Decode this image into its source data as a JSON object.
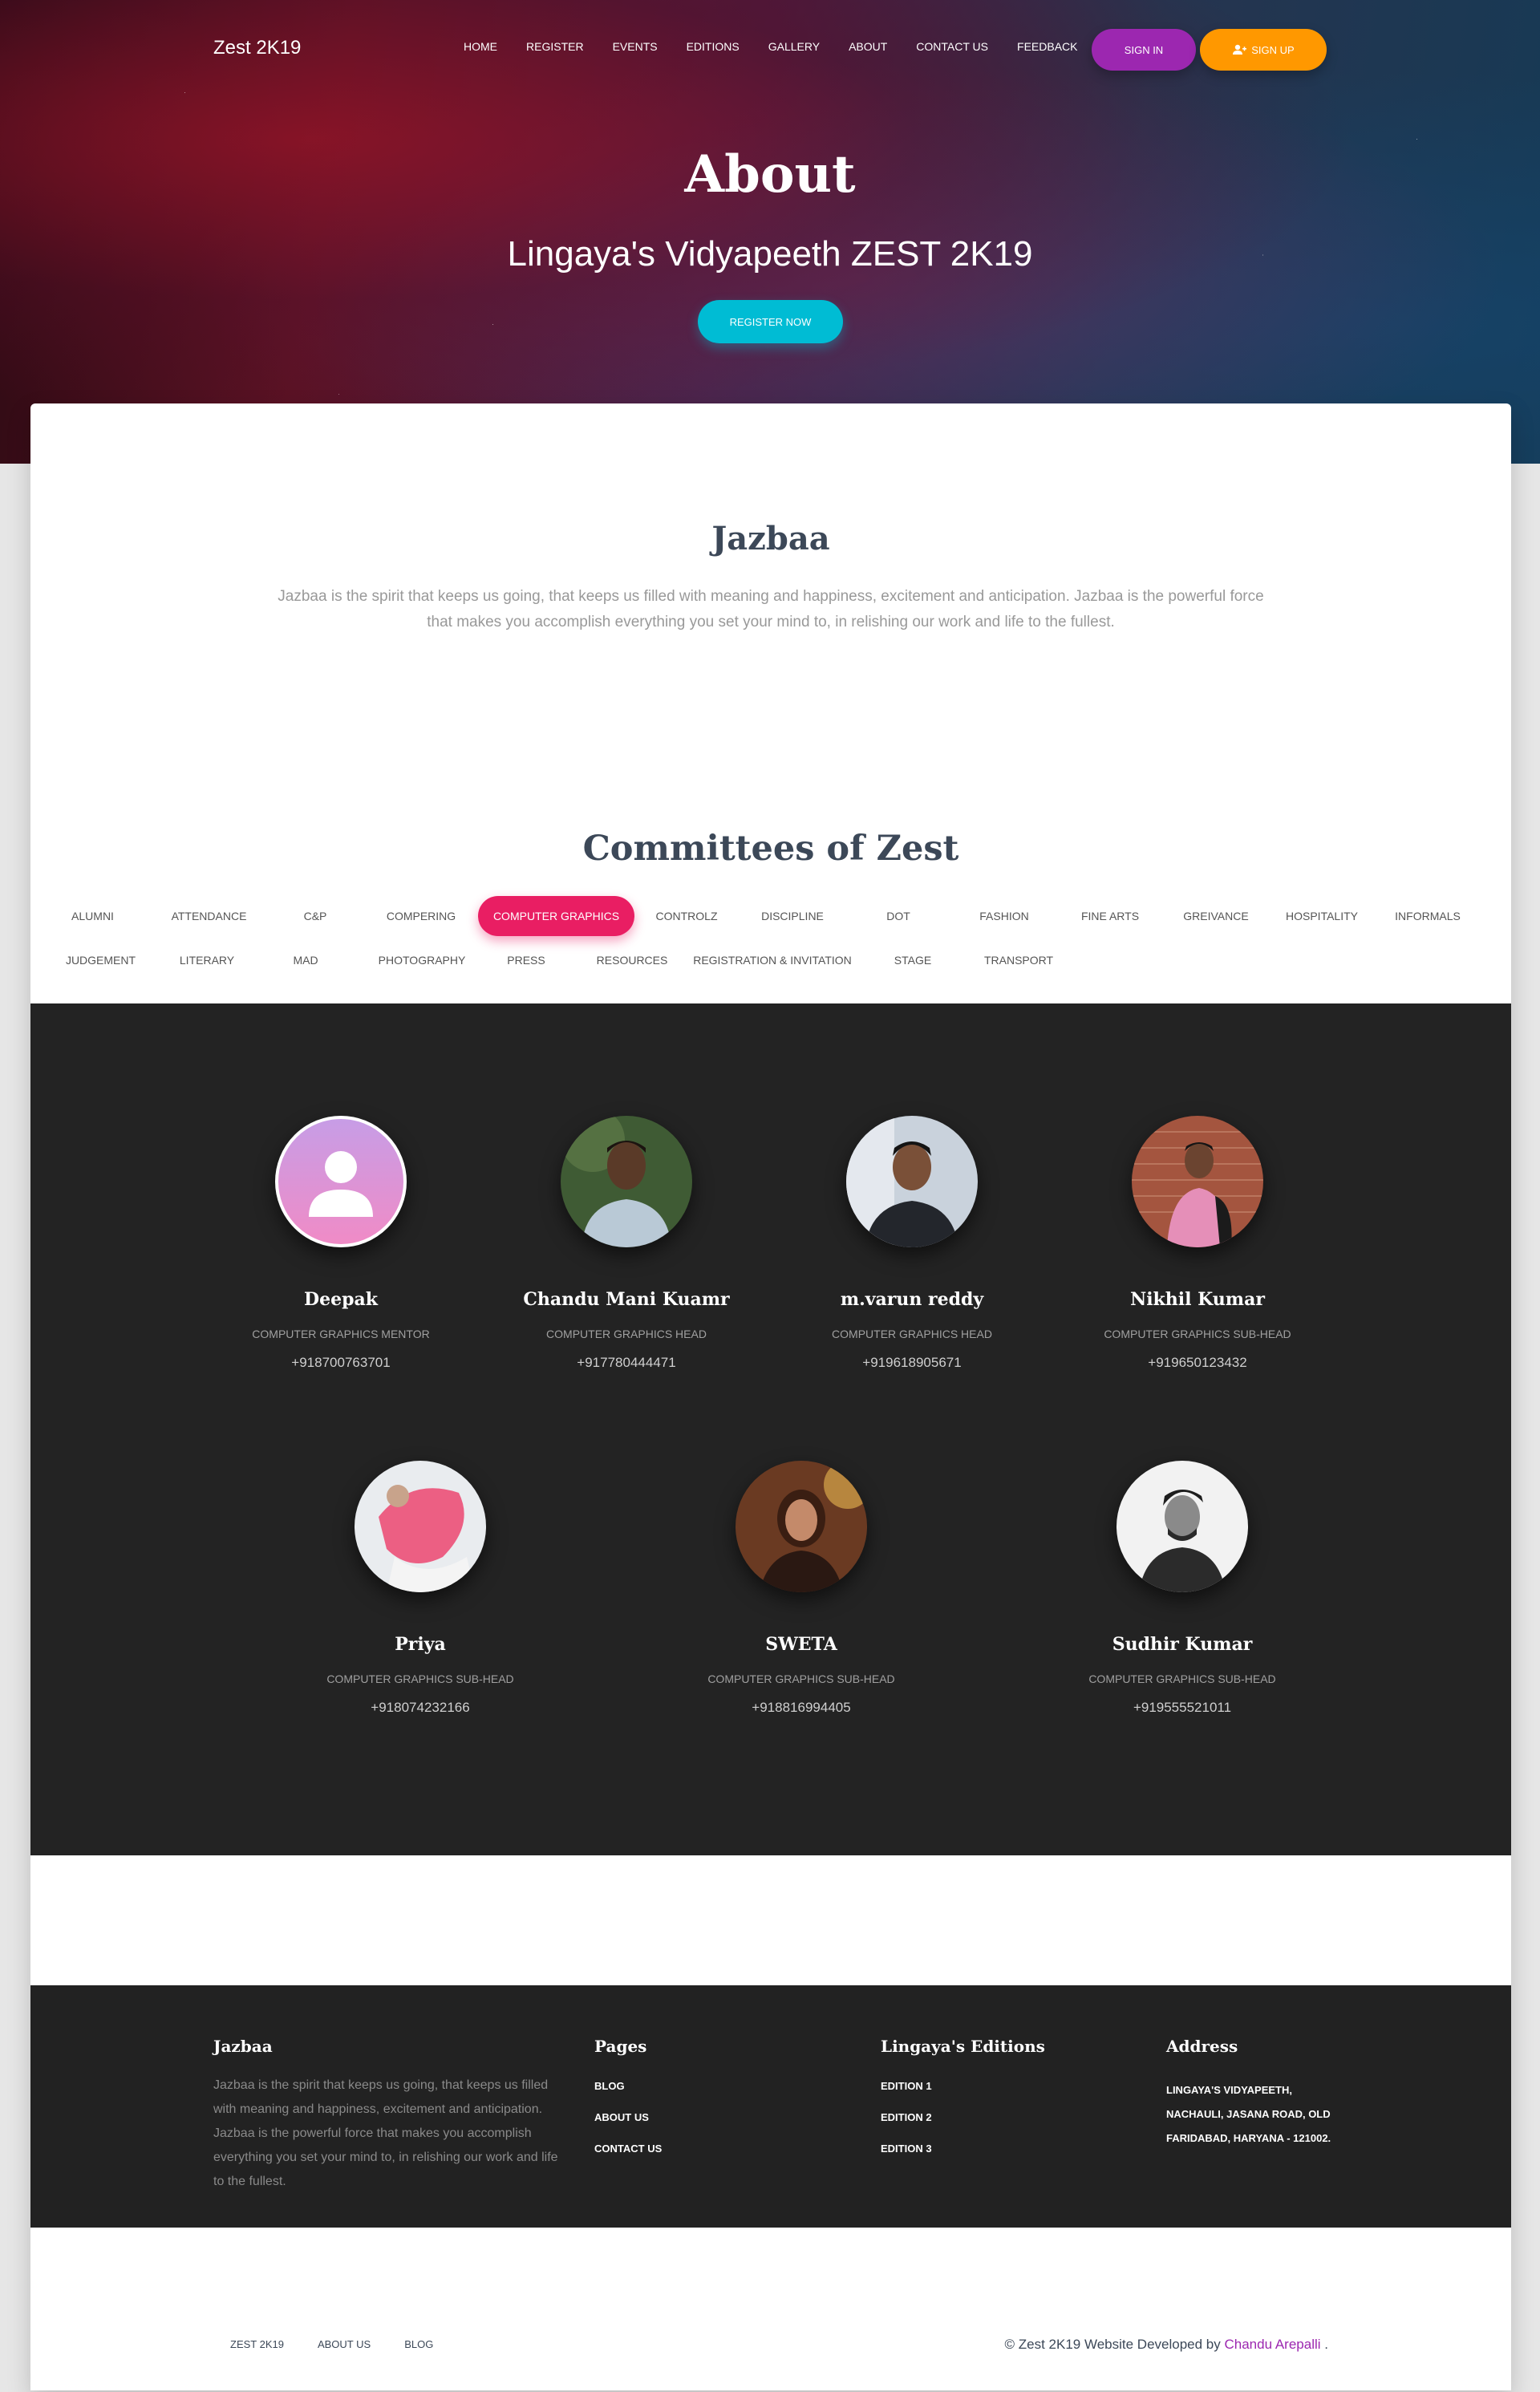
{
  "nav": {
    "brand": "Zest 2K19",
    "links": [
      "HOME",
      "REGISTER",
      "EVENTS",
      "EDITIONS",
      "GALLERY",
      "ABOUT",
      "CONTACT US",
      "FEEDBACK"
    ],
    "signin": "SIGN IN",
    "signup": "SIGN UP"
  },
  "hero": {
    "title": "About",
    "subtitle": "Lingaya's Vidyapeeth ZEST 2K19",
    "cta": "REGISTER NOW"
  },
  "intro": {
    "title": "Jazbaa",
    "text": "Jazbaa is the spirit that keeps us going, that keeps us filled with meaning and happiness, excitement and anticipation. Jazbaa is the powerful force that makes you accomplish everything you set your mind to, in relishing our work and life to the fullest."
  },
  "committees": {
    "title": "Committees of Zest",
    "tabs_row1": [
      "ALUMNI",
      "ATTENDANCE",
      "C&P",
      "COMPERING",
      "COMPUTER GRAPHICS",
      "CONTROLZ",
      "DISCIPLINE",
      "DOT",
      "FASHION",
      "FINE ARTS",
      "GREIVANCE",
      "HOSPITALITY",
      "INFORMALS"
    ],
    "tabs_row2": [
      "JUDGEMENT",
      "LITERARY",
      "MAD",
      "PHOTOGRAPHY",
      "PRESS",
      "RESOURCES",
      "REGISTRATION & INVITATION",
      "STAGE",
      "TRANSPORT"
    ],
    "active_tab": "COMPUTER GRAPHICS"
  },
  "members": [
    {
      "name": "Deepak",
      "role": "COMPUTER GRAPHICS MENTOR",
      "phone": "+918700763701"
    },
    {
      "name": "Chandu Mani Kuamr",
      "role": "COMPUTER GRAPHICS HEAD",
      "phone": "+917780444471"
    },
    {
      "name": "m.varun reddy",
      "role": "COMPUTER GRAPHICS HEAD",
      "phone": "+919618905671"
    },
    {
      "name": "Nikhil Kumar",
      "role": "COMPUTER GRAPHICS SUB-HEAD",
      "phone": "+919650123432"
    },
    {
      "name": "Priya",
      "role": "COMPUTER GRAPHICS SUB-HEAD",
      "phone": "+918074232166"
    },
    {
      "name": "SWETA",
      "role": "COMPUTER GRAPHICS SUB-HEAD",
      "phone": "+918816994405"
    },
    {
      "name": "Sudhir Kumar",
      "role": "COMPUTER GRAPHICS SUB-HEAD",
      "phone": "+919555521011"
    }
  ],
  "footer": {
    "about_title": "Jazbaa",
    "about_text": "Jazbaa is the spirit that keeps us going, that keeps us filled with meaning and happiness, excitement and anticipation. Jazbaa is the powerful force that makes you accomplish everything you set your mind to, in relishing our work and life to the fullest.",
    "pages_title": "Pages",
    "pages": [
      "BLOG",
      "ABOUT US",
      "CONTACT US"
    ],
    "editions_title": "Lingaya's Editions",
    "editions": [
      "EDITION 1",
      "EDITION 2",
      "EDITION 3"
    ],
    "address_title": "Address",
    "address": "LINGAYA'S VIDYAPEETH, NACHAULI, JASANA ROAD, OLD FARIDABAD, HARYANA - 121002."
  },
  "bottom": {
    "links": [
      "ZEST 2K19",
      "ABOUT US",
      "BLOG"
    ],
    "copyright_prefix": "© Zest 2K19 Website Developed by",
    "developer": "Chandu Arepalli",
    "copyright_suffix": "."
  },
  "colors": {
    "signin": "#9c27b0",
    "signup": "#ff9800",
    "register": "#00bcd4",
    "active_tab": "#e91e63",
    "team_bg": "#232323"
  },
  "icons": [
    "user-plus-icon",
    "default-avatar-icon"
  ]
}
